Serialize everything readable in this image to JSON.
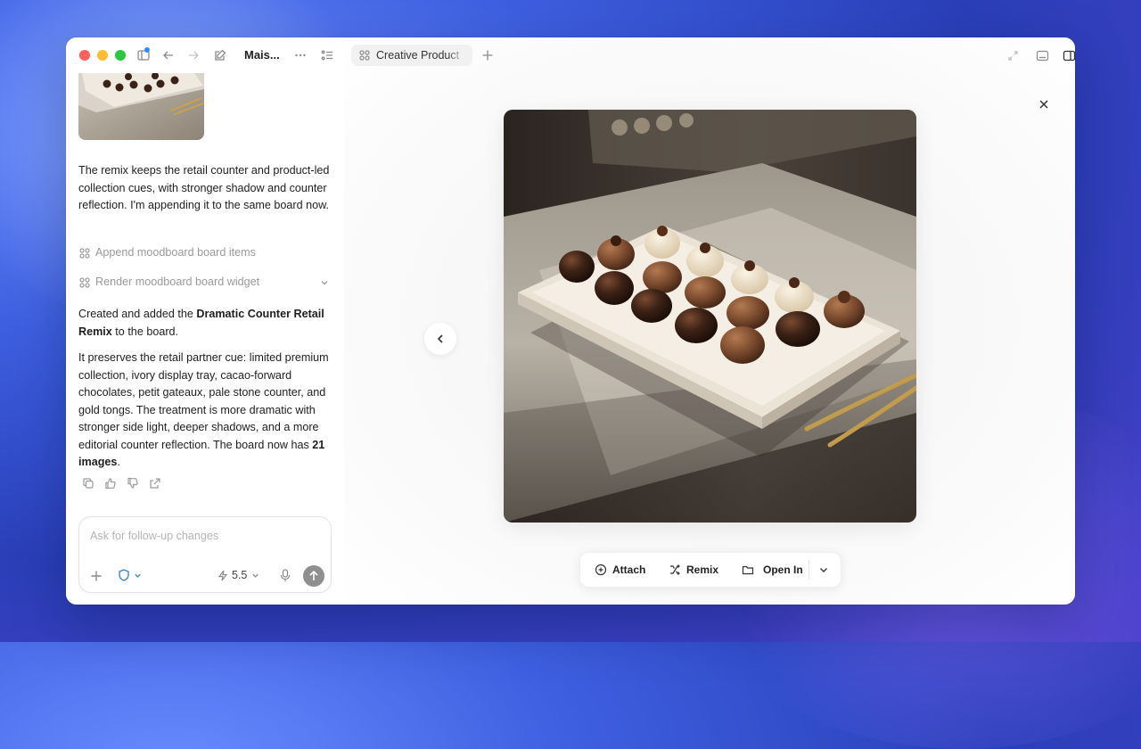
{
  "window": {
    "title": "Mais..."
  },
  "tab": {
    "label": "Creative Product"
  },
  "chat": {
    "message_1": "The remix keeps the retail counter and product-led collection cues, with stronger shadow and counter reflection. I'm appending it to the same board now.",
    "tool_1": "Append moodboard board items",
    "tool_2": "Render moodboard board widget",
    "message_2_pre": "Created and added the ",
    "message_2_bold": "Dramatic Counter Retail Remix",
    "message_2_post": " to the board.",
    "message_3_pre": "It preserves the retail partner cue: limited premium collection, ivory display tray, cacao-forward chocolates, petit gateaux, pale stone counter, and gold tongs. The treatment is more dramatic with stronger side light, deeper shadows, and a more editorial counter reflection. The board now has ",
    "message_3_bold": "21 images",
    "message_3_post": "."
  },
  "composer": {
    "placeholder": "Ask for follow-up changes",
    "model_version": "5.5"
  },
  "viewer": {
    "toolbar": {
      "attach_label": "Attach",
      "remix_label": "Remix",
      "open_in_label": "Open In"
    }
  },
  "colors": {
    "accent_blue": "#2f8bff",
    "send_button": "#8f8f8f"
  }
}
